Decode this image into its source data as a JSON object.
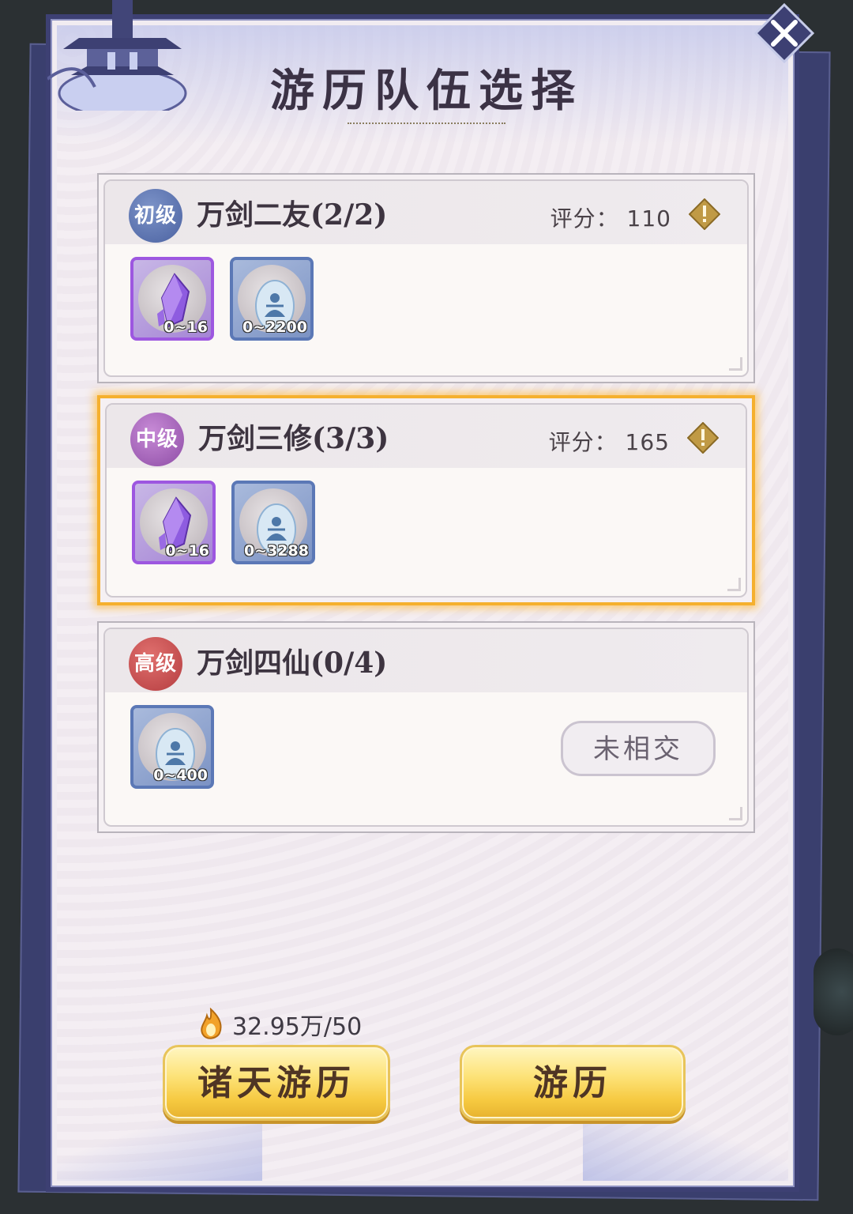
{
  "title": "游历队伍选择",
  "teams": [
    {
      "grade": "初级",
      "grade_color": "#5a70ae",
      "name": "万剑二友(2/2)",
      "score_label": "评分：",
      "score": "110",
      "selected": false,
      "items": [
        {
          "type": "purple-crystal-icon",
          "qty": "0~16"
        },
        {
          "type": "spirit-egg-icon",
          "qty": "0~2200"
        }
      ]
    },
    {
      "grade": "中级",
      "grade_color": "#a05bb8",
      "name": "万剑三修(3/3)",
      "score_label": "评分：",
      "score": "165",
      "selected": true,
      "items": [
        {
          "type": "purple-crystal-icon",
          "qty": "0~16"
        },
        {
          "type": "spirit-egg-icon",
          "qty": "0~3288"
        }
      ]
    },
    {
      "grade": "高级",
      "grade_color": "#c44a4c",
      "name": "万剑四仙(0/4)",
      "selected": false,
      "items": [
        {
          "type": "spirit-egg-icon",
          "qty": "0~400"
        }
      ],
      "status_tag": "未相交"
    }
  ],
  "currency": {
    "icon": "flame-coin-icon",
    "value": "32.95万/50"
  },
  "buttons": {
    "left": "诸天游历",
    "right": "游历"
  },
  "accent_colors": {
    "selected_border": "#f5b02e",
    "panel_border": "#3d4073",
    "button_gold": "#f6c940"
  }
}
